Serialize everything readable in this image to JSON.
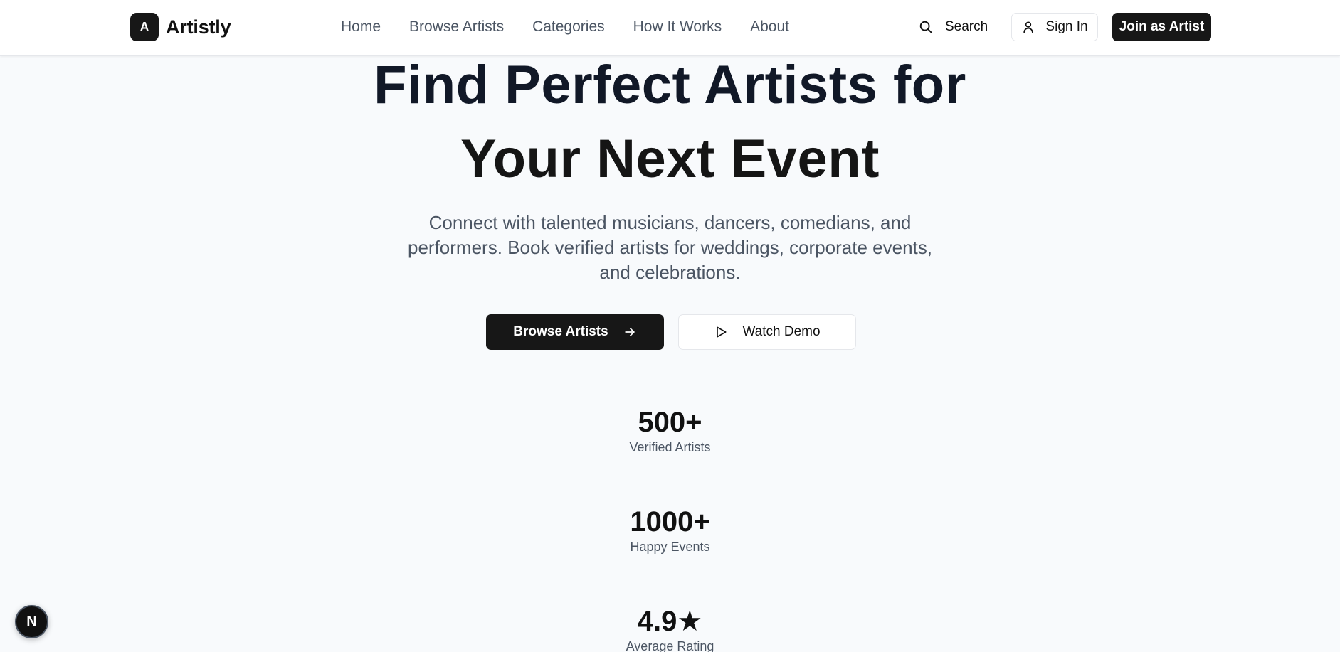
{
  "header": {
    "logo_letter": "A",
    "brand": "Artistly",
    "nav": [
      "Home",
      "Browse Artists",
      "Categories",
      "How It Works",
      "About"
    ],
    "search_label": "Search",
    "signin_label": "Sign In",
    "join_label": "Join as Artist"
  },
  "hero": {
    "title_line1": "Find Perfect Artists for",
    "title_line2": "Your Next Event",
    "subtitle": "Connect with talented musicians, dancers, comedians, and performers. Book verified artists for weddings, corporate events, and celebrations.",
    "primary_cta": "Browse Artists",
    "secondary_cta": "Watch Demo"
  },
  "stats": [
    {
      "value": "500+",
      "label": "Verified Artists"
    },
    {
      "value": "1000+",
      "label": "Happy Events"
    },
    {
      "value": "4.9★",
      "label": "Average Rating"
    }
  ],
  "fab": {
    "letter": "N"
  },
  "colors": {
    "primary": "#171717",
    "background": "#f8fafc",
    "muted_text": "#4b5563",
    "border": "#e5e7eb"
  },
  "icons": {
    "search": "search-icon",
    "user": "user-icon",
    "arrow": "arrow-right-icon",
    "play": "play-icon"
  }
}
